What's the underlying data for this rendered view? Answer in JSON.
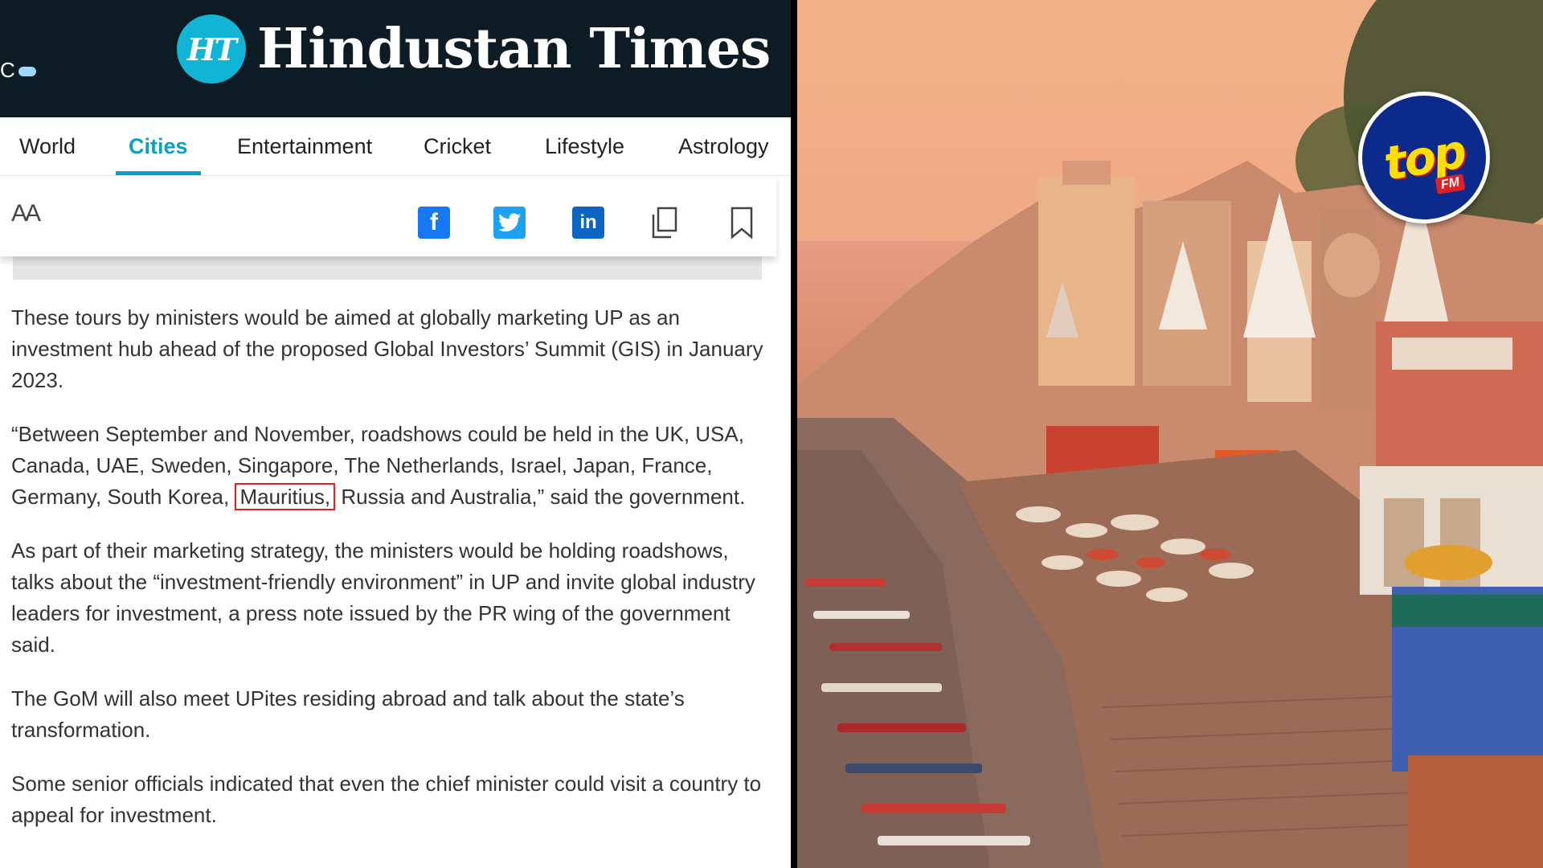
{
  "masthead": {
    "weather_text": "C",
    "logo_mark": "HT",
    "logo_name": "Hindustan Times"
  },
  "nav": {
    "items": [
      {
        "label": "World",
        "active": false
      },
      {
        "label": "Cities",
        "active": true
      },
      {
        "label": "Entertainment",
        "active": false
      },
      {
        "label": "Cricket",
        "active": false
      },
      {
        "label": "Lifestyle",
        "active": false
      },
      {
        "label": "Astrology",
        "active": false
      }
    ]
  },
  "toolbar": {
    "text_size_label": "AA",
    "icons": [
      "text-size-icon",
      "facebook-icon",
      "twitter-icon",
      "linkedin-icon",
      "copy-icon",
      "bookmark-icon"
    ]
  },
  "article": {
    "p1": "These tours by ministers would be aimed at globally marketing UP as an investment hub ahead of the proposed Global Investors’ Summit (GIS) in January 2023.",
    "p2_before": "“Between September and November, roadshows could be held in the UK, USA, Canada, UAE, Sweden, Singapore, The Netherlands, Israel, Japan, France, Germany, South Korea,",
    "p2_highlight": "Mauritius,",
    "p2_after": "Russia and Australia,” said the government.",
    "p3": "As part of their marketing strategy, the ministers would be holding roadshows, talks about the “investment-friendly environment” in UP and invite global industry leaders for investment, a press note issued by the PR wing of the government said.",
    "p4": "The GoM will also meet UPites residing abroad and talk about the state’s transformation.",
    "p5": "Some senior officials indicated that even the chief minister could visit a country to appeal for investment."
  },
  "badge": {
    "top_text": "top",
    "fm_text": "FM"
  },
  "colors": {
    "masthead_bg": "#0d1b24",
    "accent": "#0aa0c6",
    "highlight_box": "#e02020"
  }
}
